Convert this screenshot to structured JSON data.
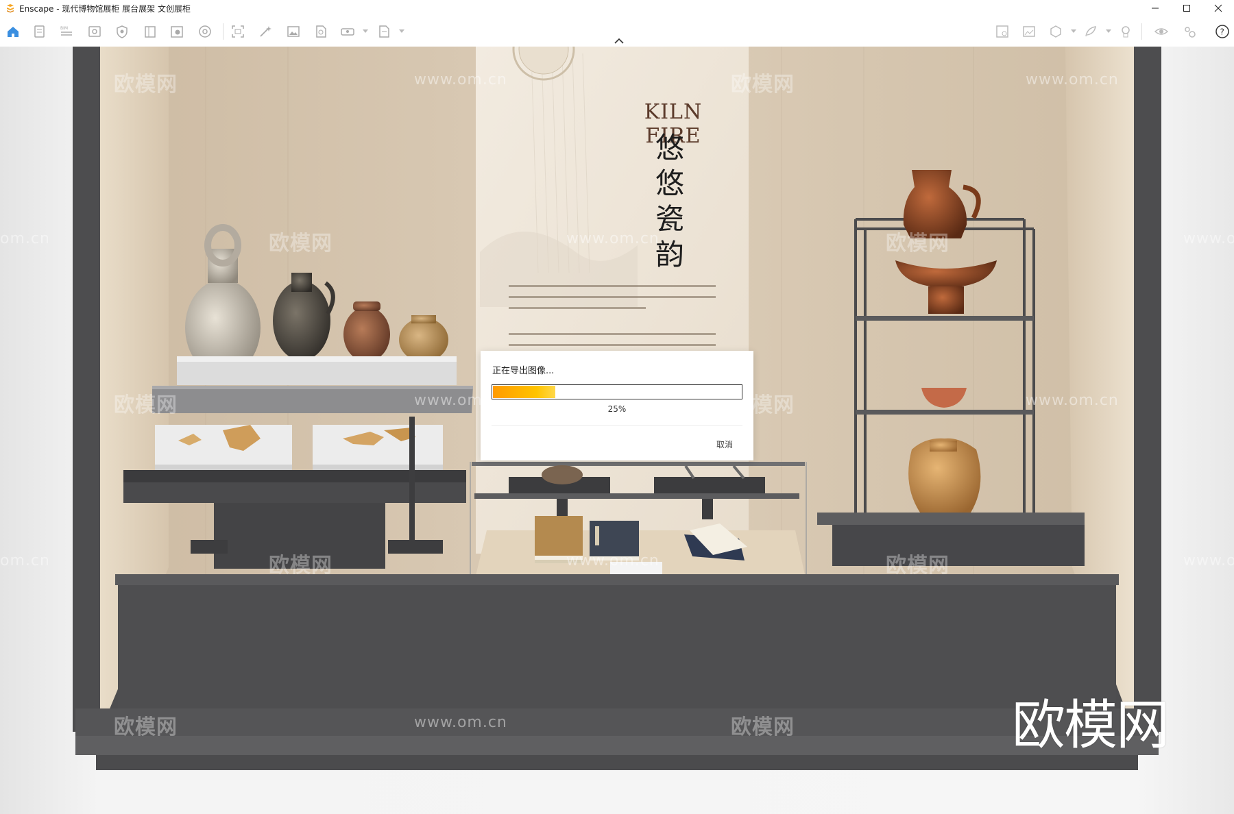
{
  "window": {
    "title": "Enscape - 现代博物馆展柜 展台展架 文创展柜",
    "controls": [
      "minimize",
      "maximize",
      "close"
    ]
  },
  "toolbar": {
    "left_icons": [
      "home-icon",
      "notes-icon",
      "bim-icon",
      "view-icon",
      "shield-icon",
      "book-icon",
      "asset-library-icon",
      "atlas-icon",
      "capture-icon",
      "magic-icon",
      "image-icon",
      "export-icon",
      "panorama-icon",
      "batch-icon"
    ],
    "right_icons": [
      "material-icon",
      "screenshot-icon",
      "box-icon",
      "feather-icon",
      "tour-icon",
      "eye-icon",
      "settings-icon",
      "help-icon"
    ]
  },
  "scene": {
    "banner_title": "KILN FIRE",
    "banner_vertical": "悠悠瓷韵",
    "logo_text": "欧模网",
    "watermark_text": "欧模网",
    "watermark_url": "www.om.cn",
    "watermark_url_partial": "om.cn"
  },
  "dialog": {
    "title": "正在导出图像...",
    "progress": 0.25,
    "progress_label": "25%",
    "cancel_label": "取消"
  },
  "colors": {
    "accent": "#3b8fe0",
    "progress_start": "#ff9a00",
    "progress_end": "#ffd84a",
    "cabinet": "#4d4d4f",
    "wall": "#d9c9b3"
  }
}
